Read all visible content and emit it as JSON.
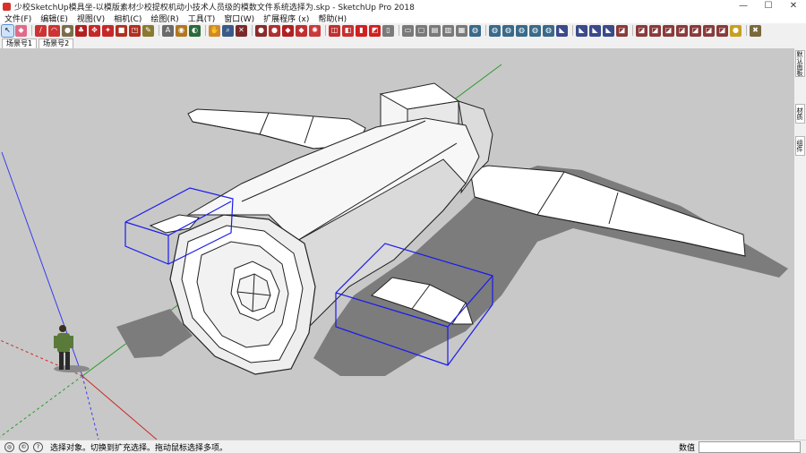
{
  "window": {
    "title": "少校SketchUp模具坐-以模版素材少校提权机动小技术人员级的模数文件系统选择为.skp - SketchUp Pro 2018",
    "minimize": "—",
    "maximize": "☐",
    "close": "✕"
  },
  "menu": [
    "文件(F)",
    "编辑(E)",
    "视图(V)",
    "相机(C)",
    "绘图(R)",
    "工具(T)",
    "窗口(W)",
    "扩展程序 (x)",
    "帮助(H)"
  ],
  "toolbar": {
    "tools": [
      {
        "name": "select-tool",
        "glyph": "↖",
        "color": "#e8f0fb"
      },
      {
        "name": "eraser-tool",
        "glyph": "◆",
        "color": "#e06a8a"
      },
      {
        "name": "pencil-tool",
        "glyph": "/",
        "color": "#cc3333"
      },
      {
        "name": "arc-tool",
        "glyph": "◠",
        "color": "#cc3333"
      },
      {
        "name": "shape-tool",
        "glyph": "●",
        "color": "#7a6f4a"
      },
      {
        "name": "pushpull-tool",
        "glyph": "♣",
        "color": "#b02020"
      },
      {
        "name": "move-tool",
        "glyph": "✥",
        "color": "#c62828"
      },
      {
        "name": "rotate-tool",
        "glyph": "✦",
        "color": "#c62828"
      },
      {
        "name": "scale-tool",
        "glyph": "■",
        "color": "#b03020"
      },
      {
        "name": "offset-tool",
        "glyph": "◳",
        "color": "#b03020"
      },
      {
        "name": "tape-measure-tool",
        "glyph": "✎",
        "color": "#8a7a30"
      },
      {
        "name": "text-tool",
        "glyph": "A",
        "color": "#6a6a6a"
      },
      {
        "name": "paint-bucket-tool",
        "glyph": "◉",
        "color": "#b07820"
      },
      {
        "name": "orbit-tool",
        "glyph": "◐",
        "color": "#2a6a3a"
      },
      {
        "name": "pan-tool",
        "glyph": "✋",
        "color": "#d08a2a"
      },
      {
        "name": "zoom-tool",
        "glyph": "⌕",
        "color": "#3a5a8a"
      },
      {
        "name": "zoom-extents-tool",
        "glyph": "✕",
        "color": "#7a2a2a"
      },
      {
        "name": "3d-warehouse-tool",
        "glyph": "●",
        "color": "#8a2a2a"
      },
      {
        "name": "extension-warehouse-tool",
        "glyph": "●",
        "color": "#b03030"
      },
      {
        "name": "sandbox-tool",
        "glyph": "◆",
        "color": "#b02020"
      },
      {
        "name": "style-tool",
        "glyph": "◆",
        "color": "#c03030"
      },
      {
        "name": "gear-tool",
        "glyph": "✺",
        "color": "#c83a3a"
      },
      {
        "name": "component-tool",
        "glyph": "◫",
        "color": "#c03030"
      },
      {
        "name": "section-tool",
        "glyph": "◧",
        "color": "#c83030"
      },
      {
        "name": "layer-tool",
        "glyph": "▮",
        "color": "#d02020"
      },
      {
        "name": "outliner-tool",
        "glyph": "◩",
        "color": "#d02020"
      },
      {
        "name": "view-iso-tool",
        "glyph": "▯",
        "color": "#7a7a7a"
      },
      {
        "name": "view-top-tool",
        "glyph": "▭",
        "color": "#7a7a7a"
      },
      {
        "name": "view-front-tool",
        "glyph": "▢",
        "color": "#7a7a7a"
      },
      {
        "name": "view-right-tool",
        "glyph": "▤",
        "color": "#7a7a7a"
      },
      {
        "name": "view-back-tool",
        "glyph": "▥",
        "color": "#7a7a7a"
      },
      {
        "name": "view-left-tool",
        "glyph": "▦",
        "color": "#7a7a7a"
      },
      {
        "name": "xray-tool",
        "glyph": "◍",
        "color": "#3a6a8a"
      },
      {
        "name": "wireframe-tool",
        "glyph": "◍",
        "color": "#3a6a8a"
      },
      {
        "name": "hidden-line-tool",
        "glyph": "◍",
        "color": "#3a6a8a"
      },
      {
        "name": "shaded-tool",
        "glyph": "◍",
        "color": "#3a6a8a"
      },
      {
        "name": "shaded-texture-tool",
        "glyph": "◍",
        "color": "#3a6a8a"
      },
      {
        "name": "monochrome-tool",
        "glyph": "◍",
        "color": "#3a6a8a"
      },
      {
        "name": "solid-union-tool",
        "glyph": "◣",
        "color": "#3a4a8a"
      },
      {
        "name": "solid-subtract-tool",
        "glyph": "◣",
        "color": "#3a4a8a"
      },
      {
        "name": "solid-trim-tool",
        "glyph": "◣",
        "color": "#3a4a8a"
      },
      {
        "name": "solid-split-tool",
        "glyph": "◣",
        "color": "#3a4a8a"
      },
      {
        "name": "plugin-tool-1",
        "glyph": "◪",
        "color": "#8a3a3a"
      },
      {
        "name": "plugin-tool-2",
        "glyph": "◪",
        "color": "#8a3a3a"
      },
      {
        "name": "plugin-tool-3",
        "glyph": "◪",
        "color": "#8a3a3a"
      },
      {
        "name": "plugin-tool-4",
        "glyph": "◪",
        "color": "#8a3a3a"
      },
      {
        "name": "plugin-tool-5",
        "glyph": "◪",
        "color": "#8a3a3a"
      },
      {
        "name": "plugin-tool-6",
        "glyph": "◪",
        "color": "#8a3a3a"
      },
      {
        "name": "plugin-tool-7",
        "glyph": "◪",
        "color": "#8a3a3a"
      },
      {
        "name": "plugin-tool-8",
        "glyph": "◪",
        "color": "#8a3a3a"
      },
      {
        "name": "plugin-tool-9",
        "glyph": "●",
        "color": "#c8a020"
      },
      {
        "name": "plugin-tool-10",
        "glyph": "✖",
        "color": "#7a6a3a"
      }
    ]
  },
  "scenes": [
    "场景号1",
    "场景号2"
  ],
  "tray_tabs": [
    "默认面板",
    "材质",
    "组件"
  ],
  "status": {
    "message": "选择对象。切换到扩充选择。拖动鼠标选择多项。",
    "measure_label": "数值",
    "measure_value": ""
  },
  "colors": {
    "viewport_bg": "#c8c8c8",
    "selection_blue": "#1a1aee",
    "axis_green": "#2a9a2a",
    "axis_blue": "#3a3aee",
    "axis_red": "#cc2a2a",
    "shadow": "#7c7c7c"
  }
}
